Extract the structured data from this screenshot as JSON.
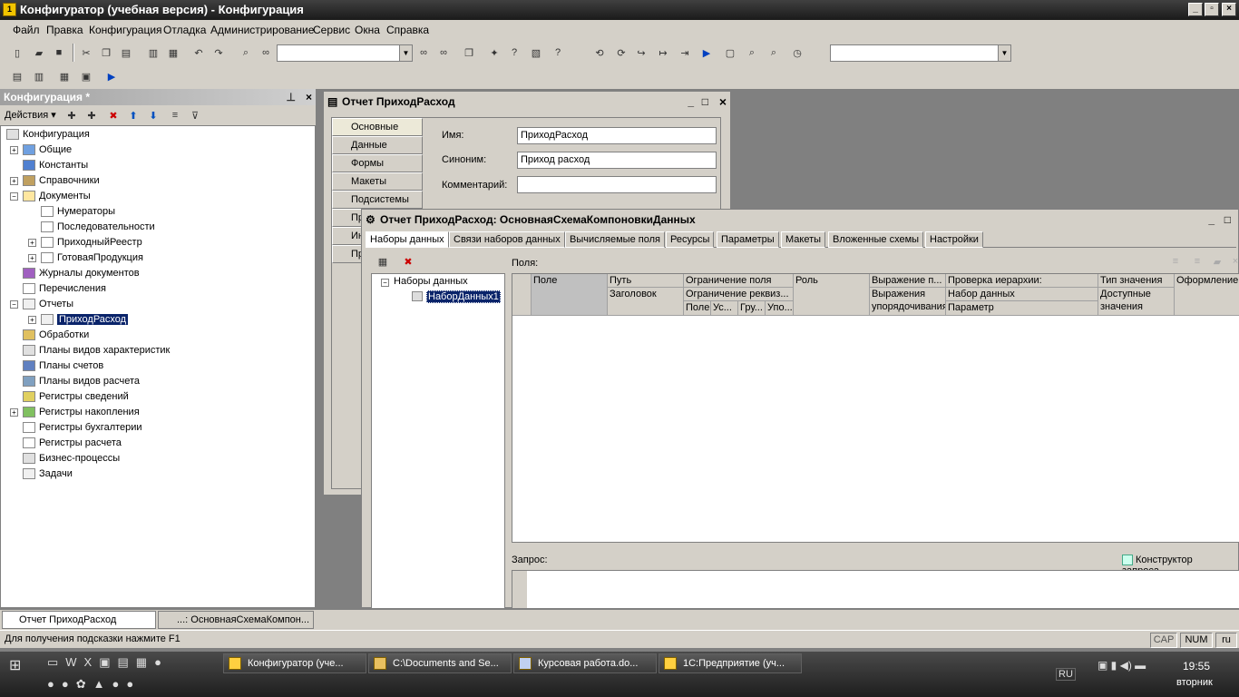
{
  "window": {
    "title": "Конфигуратор (учебная версия) - Конфигурация"
  },
  "menu": [
    "Файл",
    "Правка",
    "Конфигурация",
    "Отладка",
    "Администрирование",
    "Сервис",
    "Окна",
    "Справка"
  ],
  "config_panel": {
    "title": "Конфигурация *",
    "actions_label": "Действия",
    "tree": [
      "Конфигурация",
      "Общие",
      "Константы",
      "Справочники",
      "Документы",
      "Нумераторы",
      "Последовательности",
      "ПриходныйРеестр",
      "ГотоваяПродукция",
      "Журналы документов",
      "Перечисления",
      "Отчеты",
      "ПриходРасход",
      "Обработки",
      "Планы видов характеристик",
      "Планы счетов",
      "Планы видов расчета",
      "Регистры сведений",
      "Регистры накопления",
      "Регистры бухгалтерии",
      "Регистры расчета",
      "Бизнес-процессы",
      "Задачи"
    ]
  },
  "report_window": {
    "title": "Отчет ПриходРасход",
    "side_tabs": [
      "Основные",
      "Данные",
      "Формы",
      "Макеты",
      "Подсистемы",
      "Пр",
      "Ин",
      "Пр"
    ],
    "labels": {
      "name": "Имя:",
      "synonym": "Синоним:",
      "comment": "Комментарий:"
    },
    "values": {
      "name": "ПриходРасход",
      "synonym": "Приход расход",
      "comment": ""
    }
  },
  "schema_window": {
    "title": "Отчет ПриходРасход: ОсновнаяСхемаКомпоновкиДанных",
    "tabs": [
      "Наборы данных",
      "Связи наборов данных",
      "Вычисляемые поля",
      "Ресурсы",
      "Параметры",
      "Макеты",
      "Вложенные схемы",
      "Настройки"
    ],
    "tree_root": "Наборы данных",
    "tree_child": "НаборДанных1",
    "fields_label": "Поля:",
    "columns": {
      "field": "Поле",
      "path": "Путь",
      "title": "Заголовок",
      "restrict_field": "Ограничение поля",
      "restrict_req": "Ограничение реквиз...",
      "sub": [
        "Поле",
        "Ус...",
        "Гру...",
        "Упо..."
      ],
      "role": "Роль",
      "expr1": "Выражение п...",
      "expr2": "Выражения упорядочивания",
      "hier": "Проверка иерархии:",
      "dataset": "Набор данных",
      "param": "Параметр",
      "type": "Тип значения",
      "avail": "Доступные значения",
      "format": "Оформление"
    },
    "query_label": "Запрос:",
    "constructor_label": "Конструктор запроса..."
  },
  "bottom_tabs": [
    "Отчет ПриходРасход",
    "...: ОсновнаяСхемаКомпон..."
  ],
  "status": {
    "hint": "Для получения подсказки нажмите F1",
    "cap": "CAP",
    "num": "NUM",
    "lang": "ru"
  },
  "taskbar": {
    "buttons": [
      "Конфигуратор (уче...",
      "C:\\Documents and Se...",
      "Курсовая работа.do...",
      "1С:Предприятие (уч..."
    ],
    "lang": "RU",
    "time": "19:55",
    "day": "вторник"
  }
}
